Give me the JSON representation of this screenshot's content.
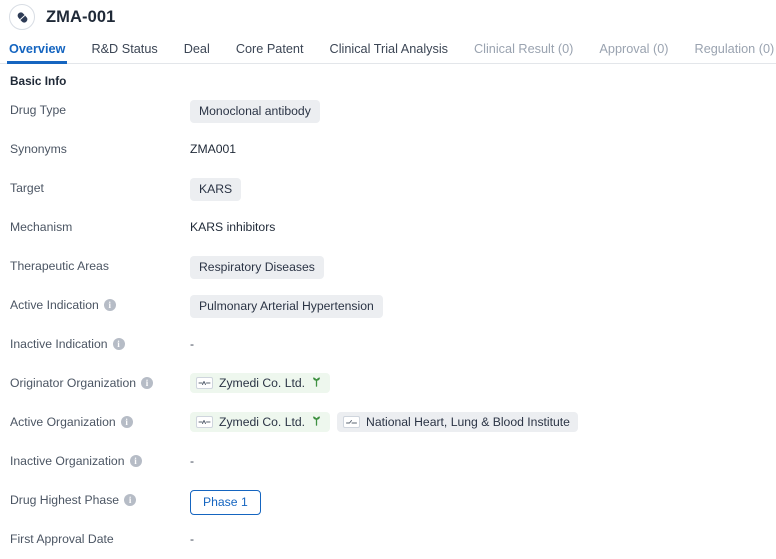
{
  "header": {
    "title": "ZMA-001",
    "icon": "pill-capsule-icon"
  },
  "tabs": [
    {
      "label": "Overview",
      "active": true,
      "muted": false
    },
    {
      "label": "R&D Status",
      "active": false,
      "muted": false
    },
    {
      "label": "Deal",
      "active": false,
      "muted": false
    },
    {
      "label": "Core Patent",
      "active": false,
      "muted": false
    },
    {
      "label": "Clinical Trial Analysis",
      "active": false,
      "muted": false
    },
    {
      "label": "Clinical Result (0)",
      "active": false,
      "muted": true
    },
    {
      "label": "Approval (0)",
      "active": false,
      "muted": true
    },
    {
      "label": "Regulation (0)",
      "active": false,
      "muted": true
    }
  ],
  "section": {
    "title": "Basic Info"
  },
  "rows": {
    "drug_type": {
      "label": "Drug Type",
      "value": "Monoclonal antibody"
    },
    "synonyms": {
      "label": "Synonyms",
      "value": "ZMA001"
    },
    "target": {
      "label": "Target",
      "value": "KARS"
    },
    "mechanism": {
      "label": "Mechanism",
      "value": "KARS inhibitors"
    },
    "therapeutic_areas": {
      "label": "Therapeutic Areas",
      "value": "Respiratory Diseases"
    },
    "active_indication": {
      "label": "Active Indication",
      "value": "Pulmonary Arterial Hypertension"
    },
    "inactive_indication": {
      "label": "Inactive Indication",
      "value": "-"
    },
    "originator_organization": {
      "label": "Originator Organization",
      "org1": "Zymedi Co. Ltd."
    },
    "active_organization": {
      "label": "Active Organization",
      "org1": "Zymedi Co. Ltd.",
      "org2": "National Heart, Lung & Blood Institute"
    },
    "inactive_organization": {
      "label": "Inactive Organization",
      "value": "-"
    },
    "drug_highest_phase": {
      "label": "Drug Highest Phase",
      "value": "Phase 1"
    },
    "first_approval_date": {
      "label": "First Approval Date",
      "value": "-"
    }
  },
  "colors": {
    "accent": "#1565c0",
    "tag_bg": "#eceef1",
    "org_green_bg": "#eef7ee",
    "sprout_green": "#3f9142",
    "label_text": "#4b5563",
    "muted_tab": "#9aa3b0"
  }
}
